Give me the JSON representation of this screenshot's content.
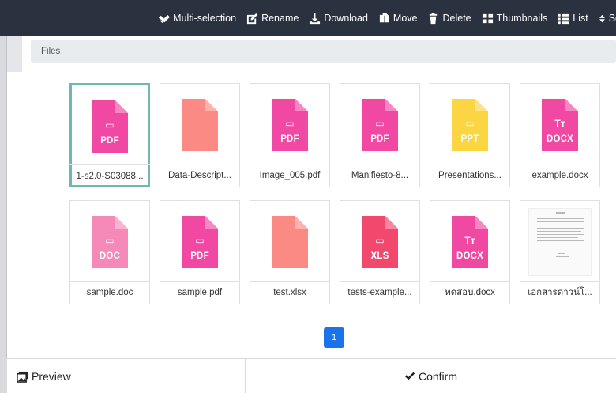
{
  "toolbar": {
    "multi_selection": "Multi-selection",
    "rename": "Rename",
    "download": "Download",
    "move": "Move",
    "delete": "Delete",
    "thumbnails": "Thumbnails",
    "list": "List",
    "sort": "So"
  },
  "breadcrumb": {
    "label": "Files"
  },
  "files": [
    {
      "name": "1-s2.0-S03088...",
      "type": "PDF",
      "color": "#f048a3",
      "glyph": "▭",
      "selected": true
    },
    {
      "name": "Data-Descript...",
      "type": "",
      "color": "#fb8a85",
      "glyph": "",
      "selected": false
    },
    {
      "name": "Image_005.pdf",
      "type": "PDF",
      "color": "#f048a3",
      "glyph": "▭",
      "selected": false
    },
    {
      "name": "Manifiesto-8...",
      "type": "PDF",
      "color": "#f048a3",
      "glyph": "▭",
      "selected": false
    },
    {
      "name": "Presentations...",
      "type": "PPT",
      "color": "#fcd542",
      "glyph": "▭",
      "selected": false
    },
    {
      "name": "example.docx",
      "type": "DOCX",
      "color": "#f048a3",
      "glyph": "Tт",
      "selected": false
    },
    {
      "name": "sample.doc",
      "type": "DOC",
      "color": "#f58ab9",
      "glyph": "▭",
      "selected": false
    },
    {
      "name": "sample.pdf",
      "type": "PDF",
      "color": "#f048a3",
      "glyph": "▭",
      "selected": false
    },
    {
      "name": "test.xlsx",
      "type": "",
      "color": "#fb8a85",
      "glyph": "",
      "selected": false
    },
    {
      "name": "tests-example...",
      "type": "XLS",
      "color": "#f2486e",
      "glyph": "▭",
      "selected": false
    },
    {
      "name": "ทดสอบ.docx",
      "type": "DOCX",
      "color": "#f048a3",
      "glyph": "Tт",
      "selected": false
    },
    {
      "name": "เอกสารดาวน์โ...",
      "type": "",
      "color": "",
      "glyph": "",
      "selected": false,
      "preview": true
    }
  ],
  "pagination": {
    "current": "1"
  },
  "bottom": {
    "preview": "Preview",
    "confirm": "Confirm"
  }
}
